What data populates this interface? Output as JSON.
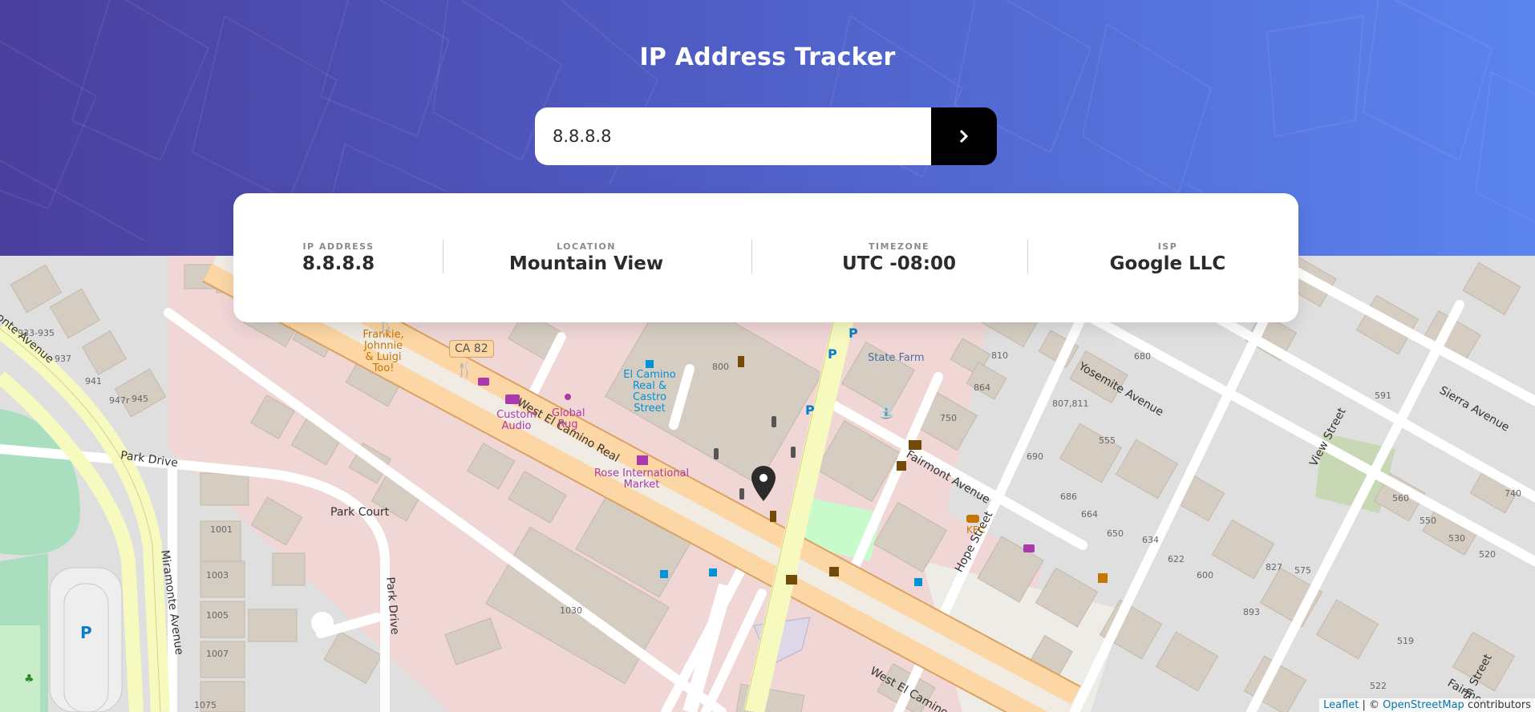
{
  "header": {
    "title": "IP Address Tracker"
  },
  "search": {
    "value": "8.8.8.8",
    "button_icon": "chevron-right-icon"
  },
  "info": {
    "ip_label": "IP ADDRESS",
    "ip_value": "8.8.8.8",
    "location_label": "LOCATION",
    "location_value": "Mountain View",
    "timezone_label": "TIMEZONE",
    "timezone_value": "UTC -08:00",
    "isp_label": "ISP",
    "isp_value": "Google LLC"
  },
  "map": {
    "marker_icon": "map-pin-icon",
    "labels": {
      "ca82": "CA 82",
      "west_el_camino_1": "West El Camino Real",
      "west_el_camino_2": "West El Camino Real",
      "fairmont_1": "Fairmont Avenue",
      "fairmont_2": "Fairmon",
      "yosemite": "Yosemite Avenue",
      "sierra": "Sierra Avenue",
      "view_street": "View Street",
      "hope_street": "Hope Street",
      "park_drive_h": "Park Drive",
      "park_drive_v": "Park Drive",
      "park_court": "Park Court",
      "miramonte_v": "Miramonte Avenue",
      "miramonte_top": "monte Avenue",
      "sh_street": "sh Street",
      "state_farm": "State Farm",
      "frankie": "Frankie, Johnnie & Luigi Too!",
      "custom_audio": "Custom Audio",
      "global_rug": "Global Rug",
      "el_camino_stop": "El Camino Real & Castro Street",
      "rose_market": "Rose International Market",
      "kfc": "KFC"
    },
    "numbers": {
      "n933": "933-935",
      "n937": "937",
      "n941": "941",
      "n947": "947r",
      "n945": "945",
      "n800": "800",
      "n810": "810",
      "n864": "864",
      "n750": "750",
      "n680": "680",
      "n807": "807,811",
      "n555": "555",
      "n591": "591",
      "n690": "690",
      "n686": "686",
      "n664": "664",
      "n650": "650",
      "n634": "634",
      "n622": "622",
      "n600": "600",
      "n560": "560",
      "n550": "550",
      "n530": "530",
      "n520": "520",
      "n740": "740",
      "n827": "827",
      "n575": "575",
      "n893": "893",
      "n519": "519",
      "n522": "522",
      "n1001": "1001",
      "n1003": "1003",
      "n1005": "1005",
      "n1007": "1007",
      "n1030": "1030",
      "n1075": "1075"
    }
  },
  "attribution": {
    "leaflet": "Leaflet",
    "separator": " | © ",
    "osm": "OpenStreetMap",
    "contributors": " contributors"
  }
}
